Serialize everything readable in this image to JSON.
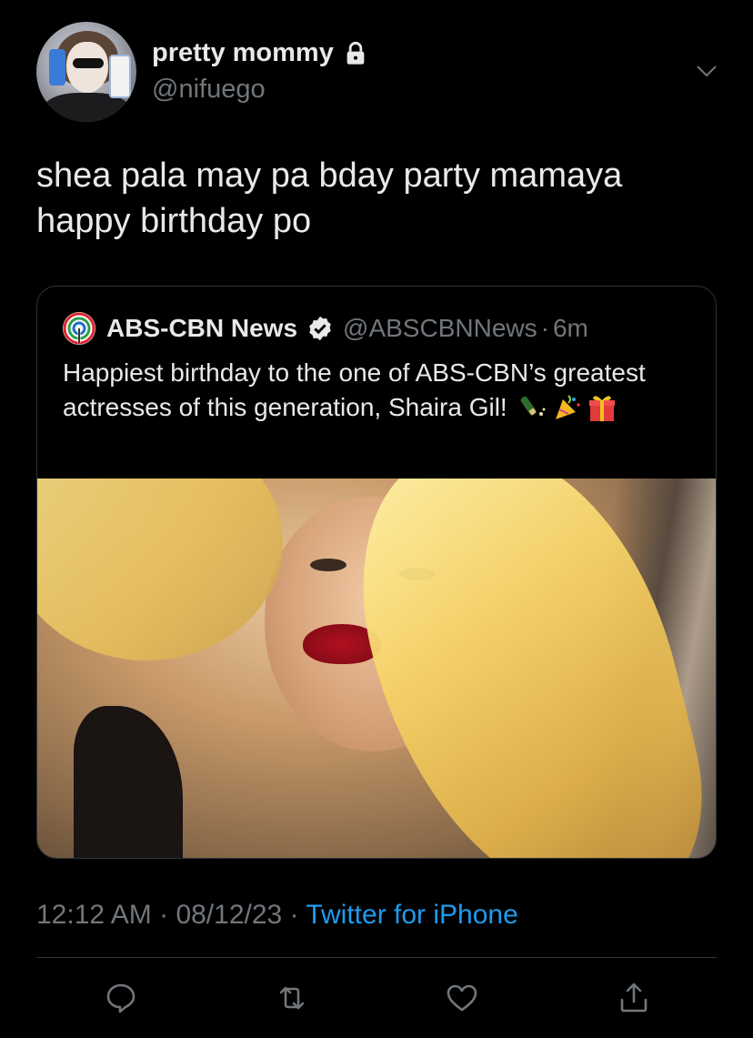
{
  "author": {
    "display_name": "pretty mommy",
    "handle": "@nifuego",
    "avatar_icon": "avatar-photo",
    "protected_icon": "lock-icon"
  },
  "tweet": {
    "text": "shea pala may pa bday party mamaya\nhappy birthday po"
  },
  "quote": {
    "name": "ABS-CBN News",
    "handle": "@ABSCBNNews",
    "separator": "·",
    "time": "6m",
    "text": "Happiest birthday to the one of ABS-CBN’s greatest actresses of this generation, Shaira Gil!",
    "emojis": [
      "champagne-icon",
      "party-popper-icon",
      "gift-icon"
    ],
    "photo_desc_icon": "photo"
  },
  "meta": {
    "time": "12:12 AM",
    "sep1": " · ",
    "date": "08/12/23",
    "sep2": " · ",
    "source": "Twitter for iPhone"
  },
  "colors": {
    "background": "#000000",
    "text": "#e7e9ea",
    "secondary": "#71767b",
    "link": "#1d9bf0",
    "border": "#2f3336"
  }
}
